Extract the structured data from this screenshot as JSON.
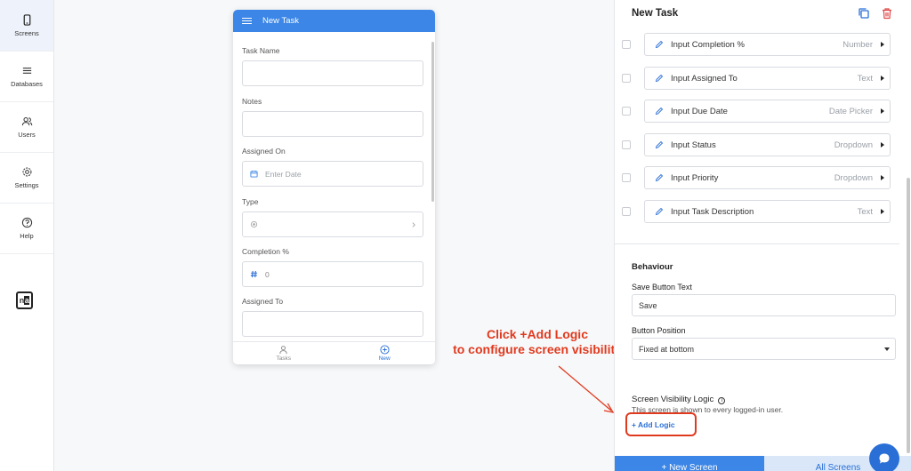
{
  "nav": {
    "items": [
      {
        "label": "Screens",
        "icon": "phone-icon"
      },
      {
        "label": "Databases",
        "icon": "list-icon"
      },
      {
        "label": "Users",
        "icon": "users-icon"
      },
      {
        "label": "Settings",
        "icon": "gear-icon"
      },
      {
        "label": "Help",
        "icon": "help-icon"
      }
    ],
    "logo": {
      "n": "n",
      "a": "a"
    }
  },
  "phone": {
    "title": "New Task",
    "fields": [
      {
        "label": "Task Name",
        "value": ""
      },
      {
        "label": "Notes",
        "value": ""
      },
      {
        "label": "Assigned On",
        "placeholder": "Enter Date"
      },
      {
        "label": "Type",
        "value": ""
      },
      {
        "label": "Completion %",
        "value": "0"
      },
      {
        "label": "Assigned To",
        "value": ""
      }
    ],
    "tabs": [
      {
        "label": "Tasks"
      },
      {
        "label": "New"
      }
    ]
  },
  "annotation": {
    "line1": "Click +Add Logic",
    "line2": "to configure screen visibility"
  },
  "panel": {
    "title": "New Task",
    "components": [
      {
        "name": "Input Completion %",
        "type": "Number"
      },
      {
        "name": "Input Assigned To",
        "type": "Text"
      },
      {
        "name": "Input Due Date",
        "type": "Date Picker"
      },
      {
        "name": "Input Status",
        "type": "Dropdown"
      },
      {
        "name": "Input Priority",
        "type": "Dropdown"
      },
      {
        "name": "Input Task Description",
        "type": "Text"
      }
    ],
    "behaviour": {
      "title": "Behaviour",
      "save_label": "Save Button Text",
      "save_value": "Save",
      "position_label": "Button Position",
      "position_value": "Fixed at bottom"
    },
    "visibility": {
      "title": "Screen Visibility Logic",
      "hint": "This screen is shown to every logged-in user.",
      "add_logic": "+ Add Logic"
    },
    "new_screen": "+ New Screen",
    "all_screens": "All Screens"
  },
  "colors": {
    "accent": "#3b86e6",
    "annotation": "#e03a1e",
    "delete": "#e04848"
  }
}
